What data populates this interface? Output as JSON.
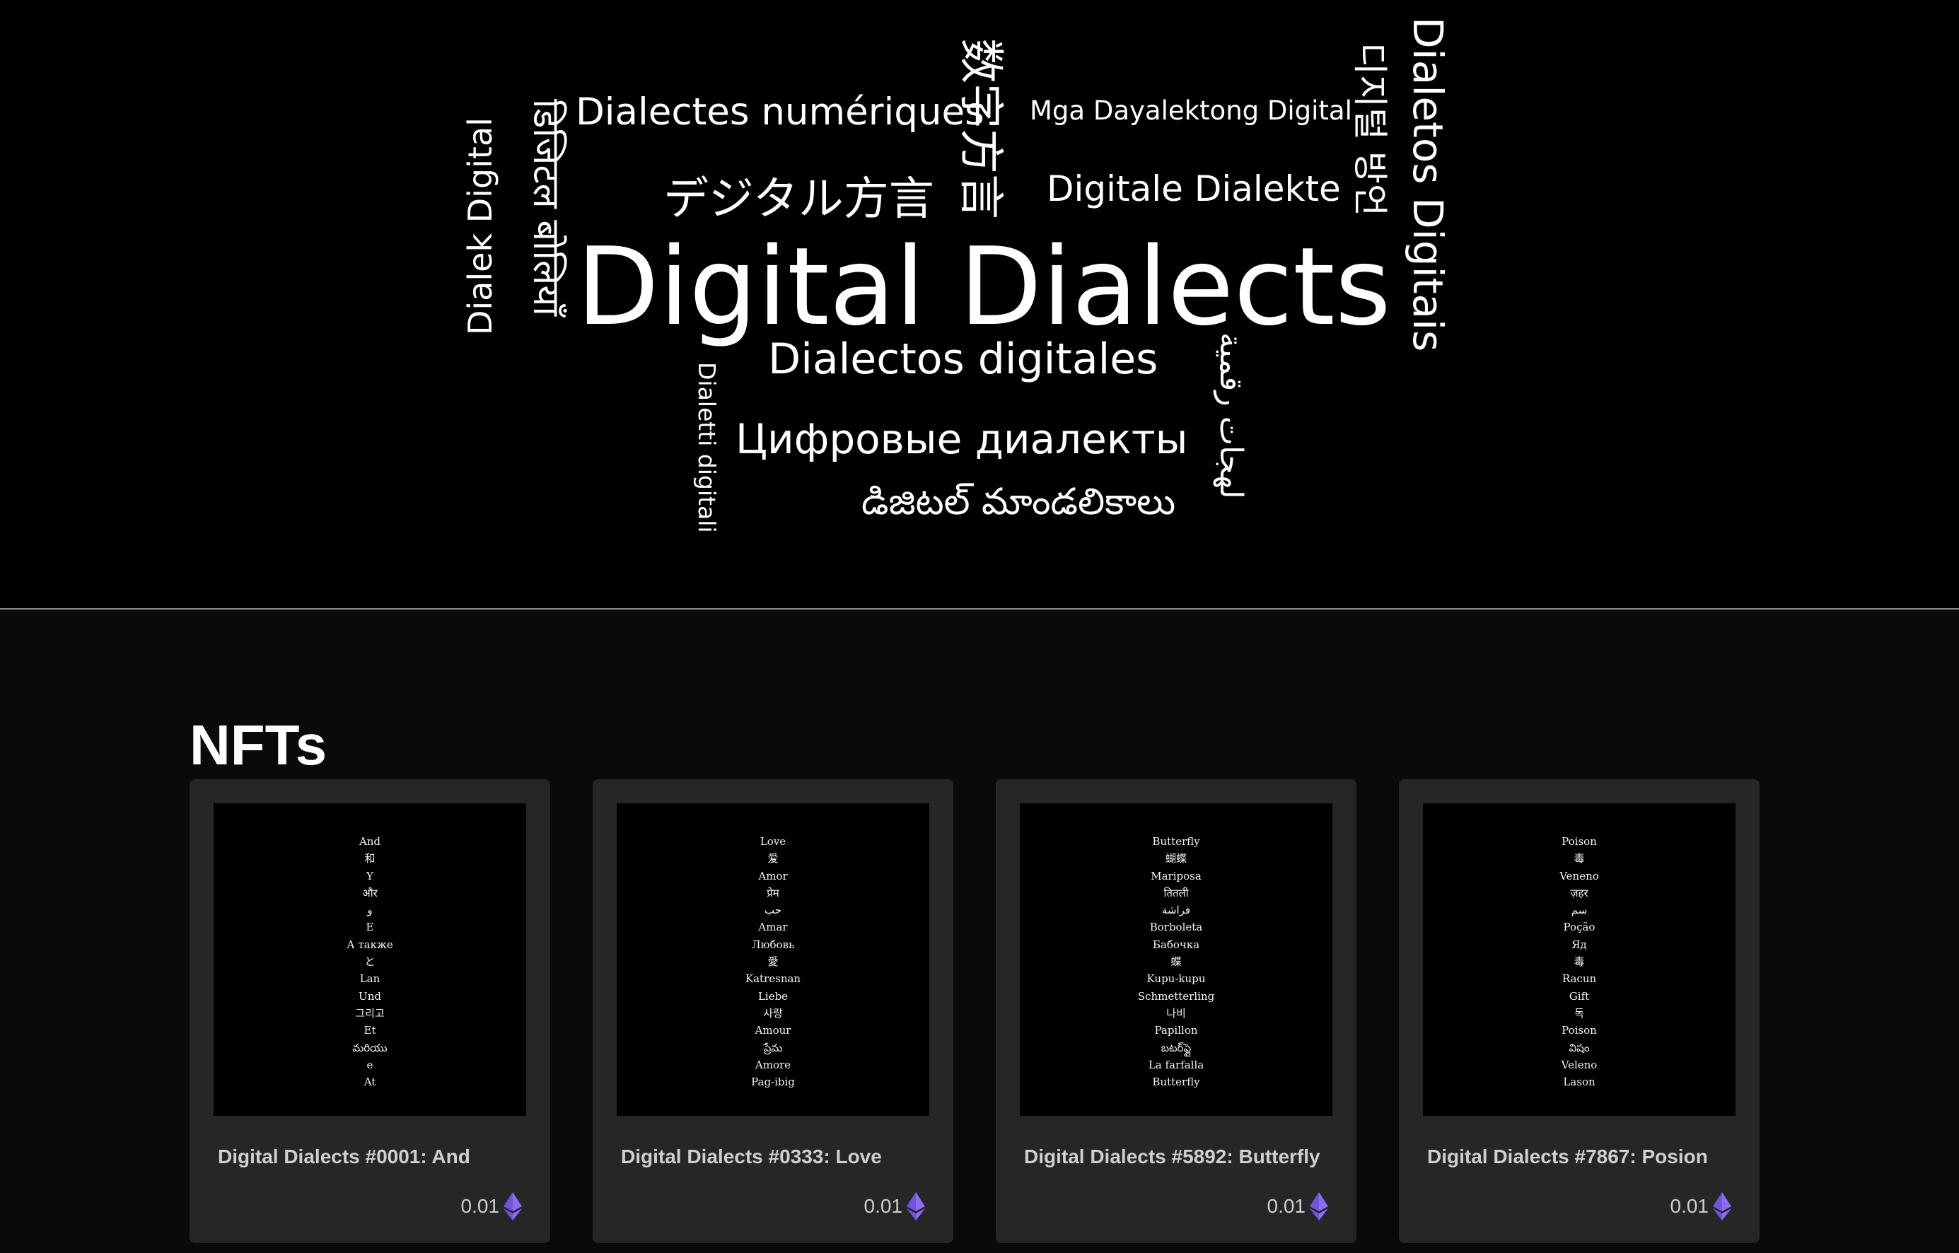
{
  "hero": {
    "title": "Digital Dialects",
    "words": {
      "french": "Dialectes numériques",
      "tagalog": "Mga Dayalektong Digital",
      "japanese": "デジタル方言",
      "german": "Digitale Dialekte",
      "spanish": "Dialectos digitales",
      "russian": "Цифровые диалекты",
      "telugu": "డిజిటల్ మాండలికాలు",
      "chinese": "数字方言",
      "indonesian": "Dialek Digital",
      "hindi": "डिजिटल बोलियाँ",
      "italian": "Dialetti digitali",
      "arabic": "لهجات رقمية",
      "korean": "디지털 방언",
      "portuguese": "Dialetos Digitais"
    }
  },
  "nfts": {
    "heading": "NFTs",
    "cards": [
      {
        "title": "Digital Dialects #0001: And",
        "price": "0.01",
        "words": [
          "And",
          "和",
          "Y",
          "और",
          "و",
          "E",
          "А также",
          "と",
          "Lan",
          "Und",
          "그리고",
          "Et",
          "మరియు",
          "e",
          "At"
        ]
      },
      {
        "title": "Digital Dialects #0333: Love",
        "price": "0.01",
        "words": [
          "Love",
          "爱",
          "Amor",
          "प्रेम",
          "حب",
          "Amar",
          "Любовь",
          "愛",
          "Katresnan",
          "Liebe",
          "사랑",
          "Amour",
          "ప్రేమ",
          "Amore",
          "Pag-ibig"
        ]
      },
      {
        "title": "Digital Dialects #5892: Butterfly",
        "price": "0.01",
        "words": [
          "Butterfly",
          "蝴蝶",
          "Mariposa",
          "तितली",
          "فراشة",
          "Borboleta",
          "Бабочка",
          "蝶",
          "Kupu-kupu",
          "Schmetterling",
          "나비",
          "Papillon",
          "బటర్‌ఫ్లై",
          "La farfalla",
          "Butterfly"
        ]
      },
      {
        "title": "Digital Dialects #7867: Posion",
        "price": "0.01",
        "words": [
          "Poison",
          "毒",
          "Veneno",
          "ज़हर",
          "سم",
          "Poção",
          "Яд",
          "毒",
          "Racun",
          "Gift",
          "독",
          "Poison",
          "విషం",
          "Veleno",
          "Lason"
        ]
      }
    ],
    "currency_icon": "ethereum-icon",
    "eth_colors": [
      "#8c6cf0",
      "#5b3fcf"
    ]
  }
}
